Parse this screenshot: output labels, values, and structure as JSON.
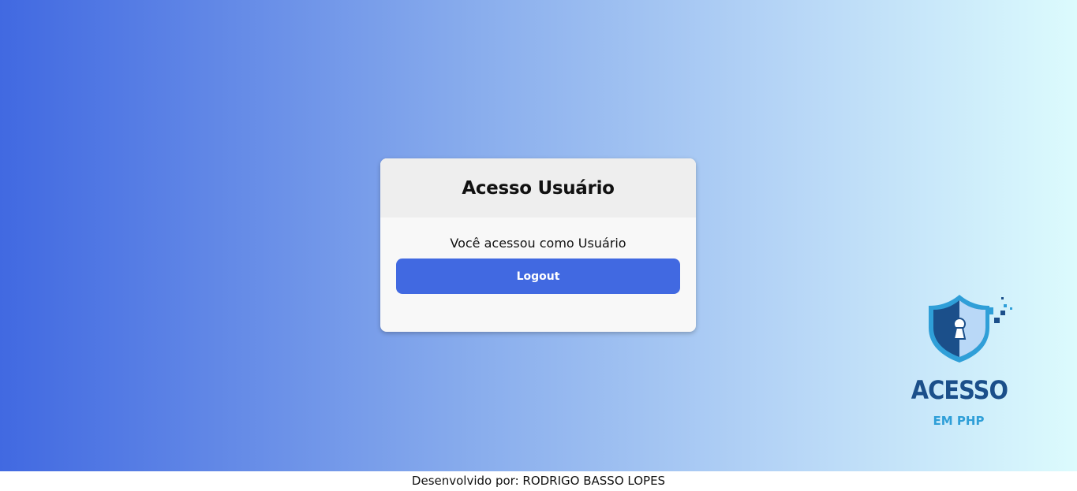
{
  "card": {
    "title": "Acesso Usuário",
    "status_text": "Você acessou como Usuário",
    "logout_label": "Logout"
  },
  "logo": {
    "icon": "shield-keyhole-icon",
    "title": "ACESSO",
    "subtitle": "EM PHP"
  },
  "footer": {
    "text": "Desenvolvido por: RODRIGO BASSO LOPES"
  },
  "colors": {
    "gradient_start": "#4169e1",
    "gradient_end": "#dcfbfd",
    "button": "#4169e1",
    "logo_dark": "#1b4f8a",
    "logo_light": "#2f9fd8"
  }
}
